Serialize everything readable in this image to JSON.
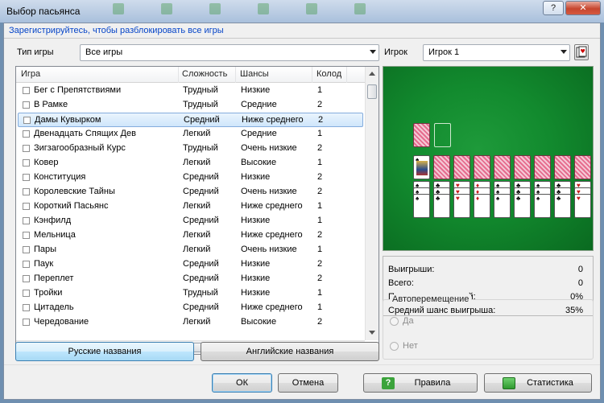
{
  "window": {
    "title": "Выбор пасьянса",
    "help_label": "?",
    "close_label": "✕"
  },
  "unlock_link": "Зарегистрируйтесь, чтобы разблокировать все игры",
  "game_type": {
    "label": "Тип игры",
    "value": "Все игры"
  },
  "player": {
    "label": "Игрок",
    "value": "Игрок 1"
  },
  "columns": [
    "Игра",
    "Сложность",
    "Шансы",
    "Колод"
  ],
  "games": [
    [
      "Бег с Препятствиями",
      "Трудный",
      "Низкие",
      "1"
    ],
    [
      "В Рамке",
      "Трудный",
      "Средние",
      "2"
    ],
    [
      "Дамы Кувырком",
      "Средний",
      "Ниже среднего",
      "2"
    ],
    [
      "Двенадцать Спящих Дев",
      "Легкий",
      "Средние",
      "1"
    ],
    [
      "Зигзагообразный Курс",
      "Трудный",
      "Очень низкие",
      "2"
    ],
    [
      "Ковер",
      "Легкий",
      "Высокие",
      "1"
    ],
    [
      "Конституция",
      "Средний",
      "Низкие",
      "2"
    ],
    [
      "Королевские Тайны",
      "Средний",
      "Очень низкие",
      "2"
    ],
    [
      "Короткий Пасьянс",
      "Легкий",
      "Ниже среднего",
      "1"
    ],
    [
      "Кэнфилд",
      "Средний",
      "Низкие",
      "1"
    ],
    [
      "Мельница",
      "Легкий",
      "Ниже среднего",
      "2"
    ],
    [
      "Пары",
      "Легкий",
      "Очень низкие",
      "1"
    ],
    [
      "Паук",
      "Средний",
      "Низкие",
      "2"
    ],
    [
      "Переплет",
      "Средний",
      "Низкие",
      "2"
    ],
    [
      "Тройки",
      "Трудный",
      "Низкие",
      "1"
    ],
    [
      "Цитадель",
      "Средний",
      "Ниже среднего",
      "1"
    ],
    [
      "Чередование",
      "Легкий",
      "Высокие",
      "2"
    ]
  ],
  "selected_game": "Дамы Кувырком",
  "name_buttons": {
    "russian": "Русские названия",
    "english": "Английские названия"
  },
  "stats": [
    {
      "label": "Выигрыши:",
      "value": "0"
    },
    {
      "label": "Всего:",
      "value": "0"
    },
    {
      "label": "Процент выигрышей:",
      "value": "0%"
    },
    {
      "label": "Средний шанс выигрыша:",
      "value": "35%"
    }
  ],
  "automove": {
    "title": "Автоперемещение",
    "yes": "Да",
    "no": "Нет"
  },
  "buttons": {
    "ok": "ОК",
    "cancel": "Отмена",
    "rules": "Правила",
    "statistics": "Статистика"
  },
  "icons": [
    "help-icon",
    "close-icon",
    "dropdown-arrow-icon",
    "player-settings-icon",
    "rules-icon",
    "statistics-icon"
  ]
}
